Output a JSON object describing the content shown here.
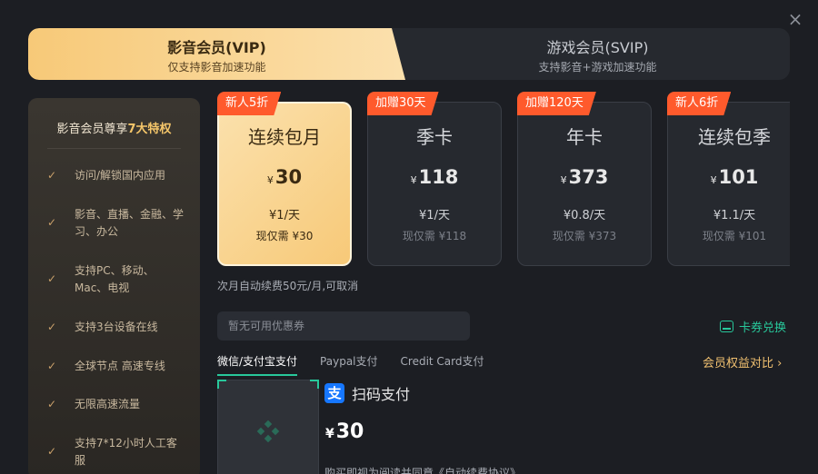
{
  "close_symbol": "×",
  "tabs": {
    "vip": {
      "title": "影音会员(VIP)",
      "subtitle": "仅支持影音加速功能"
    },
    "svip": {
      "title": "游戏会员(SVIP)",
      "subtitle": "支持影音+游戏加速功能"
    }
  },
  "features": {
    "title_prefix": "影音会员尊享",
    "title_highlight": "7大特权",
    "check_symbol": "✓",
    "items": [
      "访问/解锁国内应用",
      "影音、直播、金融、学习、办公",
      "支持PC、移动、Mac、电视",
      "支持3台设备在线",
      "全球节点 高速专线",
      "无限高速流量",
      "支持7*12小时人工客服"
    ]
  },
  "plans": [
    {
      "badge": "新人5折",
      "name": "连续包月",
      "currency": "¥",
      "price": "30",
      "per_day": "¥1/天",
      "now": "现仅需 ¥30",
      "selected": true
    },
    {
      "badge": "加赠30天",
      "name": "季卡",
      "currency": "¥",
      "price": "118",
      "per_day": "¥1/天",
      "now": "现仅需 ¥118",
      "selected": false
    },
    {
      "badge": "加赠120天",
      "name": "年卡",
      "currency": "¥",
      "price": "373",
      "per_day": "¥0.8/天",
      "now": "现仅需 ¥373",
      "selected": false
    },
    {
      "badge": "新人6折",
      "name": "连续包季",
      "currency": "¥",
      "price": "101",
      "per_day": "¥1.1/天",
      "now": "现仅需 ¥101",
      "selected": false
    }
  ],
  "renew_note": "次月自动续费50元/月,可取消",
  "coupon": {
    "placeholder": "暂无可用优惠券"
  },
  "voucher_label": "卡券兑换",
  "pay_tabs": [
    "微信/支付宝支付",
    "Paypal支付",
    "Credit Card支付"
  ],
  "compare_label": "会员权益对比 ›",
  "scan": {
    "icon_char": "支",
    "label": "扫码支付"
  },
  "pay_amount": {
    "currency": "¥",
    "value": "30"
  },
  "agree_text": "购买即视为阅读并同意《自动续费协议》",
  "colors": {
    "accent_green": "#28c89b",
    "badge_orange": "#ff5a2c",
    "gold": "#f7c978"
  }
}
